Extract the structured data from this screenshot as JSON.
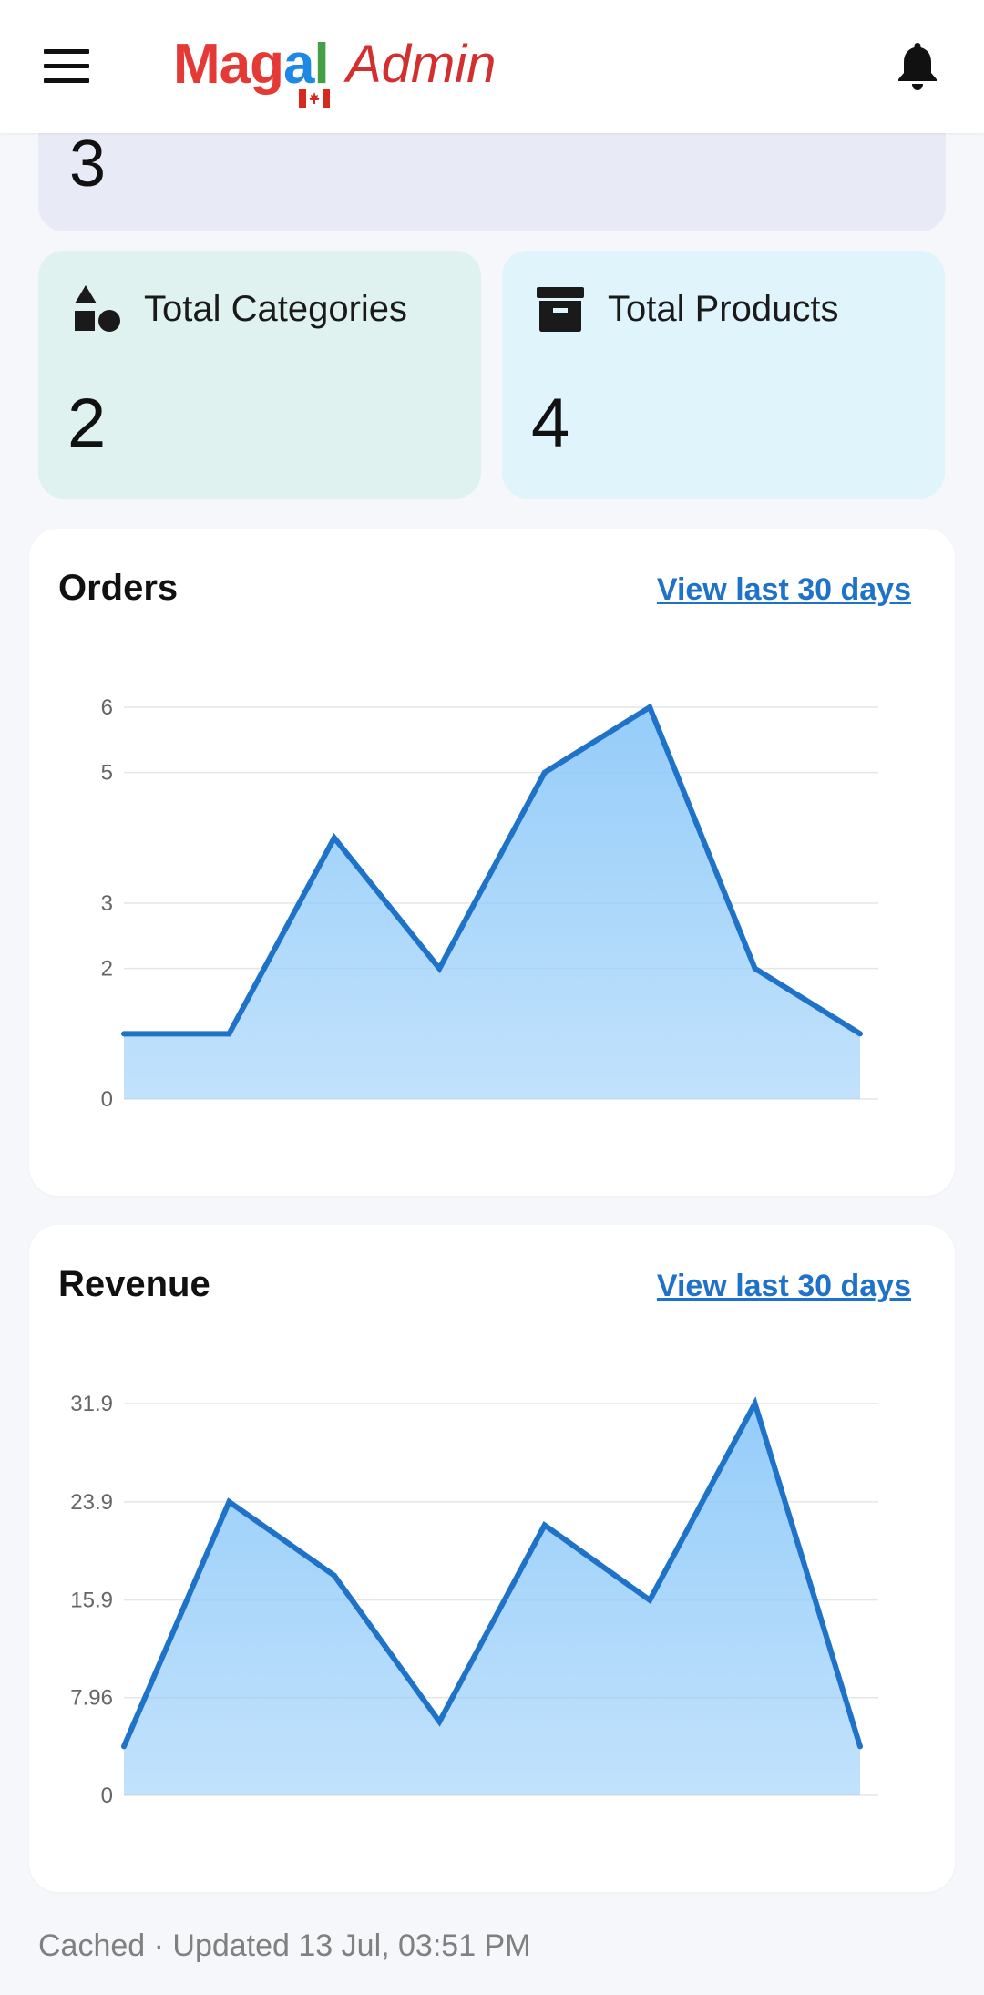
{
  "header": {
    "logo_parts": [
      {
        "text": "Ma",
        "color": "#e53935"
      },
      {
        "text": "g",
        "color": "#e53935"
      },
      {
        "text": "a",
        "color": "#1e88e5"
      },
      {
        "text": "l",
        "color": "#43a047"
      }
    ],
    "logo_admin": "Admin",
    "admin_color": "#d32f2f",
    "icons": {
      "menu": "hamburger-menu-icon",
      "notifications": "bell-icon",
      "flag": "canada-flag-icon"
    }
  },
  "top_card": {
    "value": "3"
  },
  "stats": [
    {
      "label": "Total Categories",
      "value": "2",
      "icon": "shapes-icon",
      "bg": "#e0f2ef"
    },
    {
      "label": "Total Products",
      "value": "4",
      "icon": "archive-box-icon",
      "bg": "#e0f4fc"
    }
  ],
  "orders_card": {
    "title": "Orders",
    "link": "View last 30 days"
  },
  "revenue_card": {
    "title": "Revenue",
    "link": "View last 30 days"
  },
  "footer": {
    "text": "Cached · Updated 13 Jul, 03:51 PM"
  },
  "chart_data": [
    {
      "type": "area",
      "title": "Orders",
      "x": [
        1,
        2,
        3,
        4,
        5,
        6,
        7,
        8
      ],
      "values": [
        1,
        1,
        4,
        2,
        5,
        6,
        2,
        1
      ],
      "yticks": [
        "0",
        "2",
        "3",
        "5",
        "6"
      ],
      "ylim": [
        0,
        6
      ],
      "grid": true,
      "line_color": "#1e72c8",
      "fill_color": "#90caf9"
    },
    {
      "type": "area",
      "title": "Revenue",
      "x": [
        1,
        2,
        3,
        4,
        5,
        6,
        7,
        8
      ],
      "values": [
        3.98,
        23.9,
        17.9,
        6,
        22,
        15.9,
        31.9,
        3.98
      ],
      "yticks": [
        "0",
        "7.96",
        "15.9",
        "23.9",
        "31.9"
      ],
      "ylim": [
        0,
        31.9
      ],
      "grid": true,
      "line_color": "#1e72c8",
      "fill_color": "#90caf9"
    }
  ]
}
